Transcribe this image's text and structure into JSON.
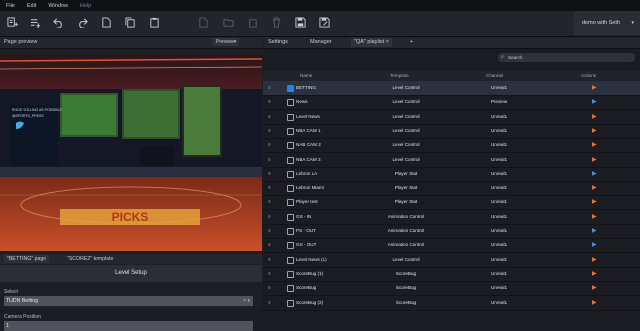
{
  "menu": [
    "File",
    "Edit",
    "Window",
    "Help"
  ],
  "toolbar_icons": [
    "rundown-add-icon",
    "playlist-add-icon",
    "undo-icon",
    "redo-icon",
    "new-page-icon",
    "copy-icon",
    "clipboard-icon",
    "new-file-icon",
    "folder-icon",
    "duplicate-icon",
    "delete-icon",
    "save-icon",
    "save-as-icon"
  ],
  "user": {
    "label": "demo with Seth"
  },
  "preview_tab": {
    "title": "Page preview",
    "mode": "Preview"
  },
  "scene": {
    "twitter_text1": "RODS YOLLING AS POSSIBLE",
    "twitter_text2": "@SPORTS_PRESS",
    "floor_logo": "PICKS"
  },
  "bottom_tabs": {
    "tab1": "\"BETTING\" page",
    "tab2": "\"SCORE2\" template"
  },
  "level_setup": {
    "title": "Level Setup",
    "select_label": "Select",
    "select_value": "TUDN Betting",
    "camera_label": "Camera Position",
    "camera_value": "1"
  },
  "right_tabs": [
    "Settings",
    "Manager",
    "\"QA\" playlist",
    "+"
  ],
  "search": {
    "placeholder": "Search"
  },
  "table": {
    "headers": {
      "name": "Name",
      "template": "Template",
      "channel": "Channel",
      "actions": "Actions"
    },
    "rows": [
      {
        "name": "BETTING",
        "template": "Level Control",
        "channel": "Unreal1",
        "checked": true,
        "play": "orange"
      },
      {
        "name": "News",
        "template": "Level Control",
        "channel": "Preview",
        "checked": false,
        "play": "blue"
      },
      {
        "name": "Level News",
        "template": "Level Control",
        "channel": "Unreal1",
        "checked": false,
        "play": "orange"
      },
      {
        "name": "NBA CAM 1",
        "template": "Level Control",
        "channel": "Unreal1",
        "checked": false,
        "play": "orange"
      },
      {
        "name": "NAB CAM 2",
        "template": "Level Control",
        "channel": "Unreal1",
        "checked": false,
        "play": "orange"
      },
      {
        "name": "NBA CAM 3",
        "template": "Level Control",
        "channel": "Unreal1",
        "checked": false,
        "play": "orange"
      },
      {
        "name": "Lebron LA",
        "template": "Player Stat",
        "channel": "Unreal1",
        "checked": false,
        "play": "blue"
      },
      {
        "name": "Lebron Miami",
        "template": "Player Stat",
        "channel": "Unreal1",
        "checked": false,
        "play": "orange"
      },
      {
        "name": "Player test",
        "template": "Player Stat",
        "channel": "Unreal1",
        "checked": false,
        "play": "orange"
      },
      {
        "name": "GS - IN",
        "template": "Animation Control",
        "channel": "Unreal1",
        "checked": false,
        "play": "orange"
      },
      {
        "name": "PS - OUT",
        "template": "Animation Control",
        "channel": "Unreal1",
        "checked": false,
        "play": "blue"
      },
      {
        "name": "GS - OUT",
        "template": "Animation Control",
        "channel": "Unreal1",
        "checked": false,
        "play": "blue"
      },
      {
        "name": "Level News (1)",
        "template": "Level Control",
        "channel": "Unreal1",
        "checked": false,
        "play": "orange"
      },
      {
        "name": "ScoreBug (1)",
        "template": "ScoreBug",
        "channel": "Unreal1",
        "checked": false,
        "play": "orange"
      },
      {
        "name": "ScoreBug",
        "template": "ScoreBug",
        "channel": "Unreal1",
        "checked": false,
        "play": "orange"
      },
      {
        "name": "ScoreBug (2)",
        "template": "ScoreBug",
        "channel": "Unreal1",
        "checked": false,
        "play": "orange"
      }
    ]
  },
  "colors": {
    "orange": "#e8743b",
    "blue": "#4a90d9",
    "accent": "#2f7fe0"
  }
}
